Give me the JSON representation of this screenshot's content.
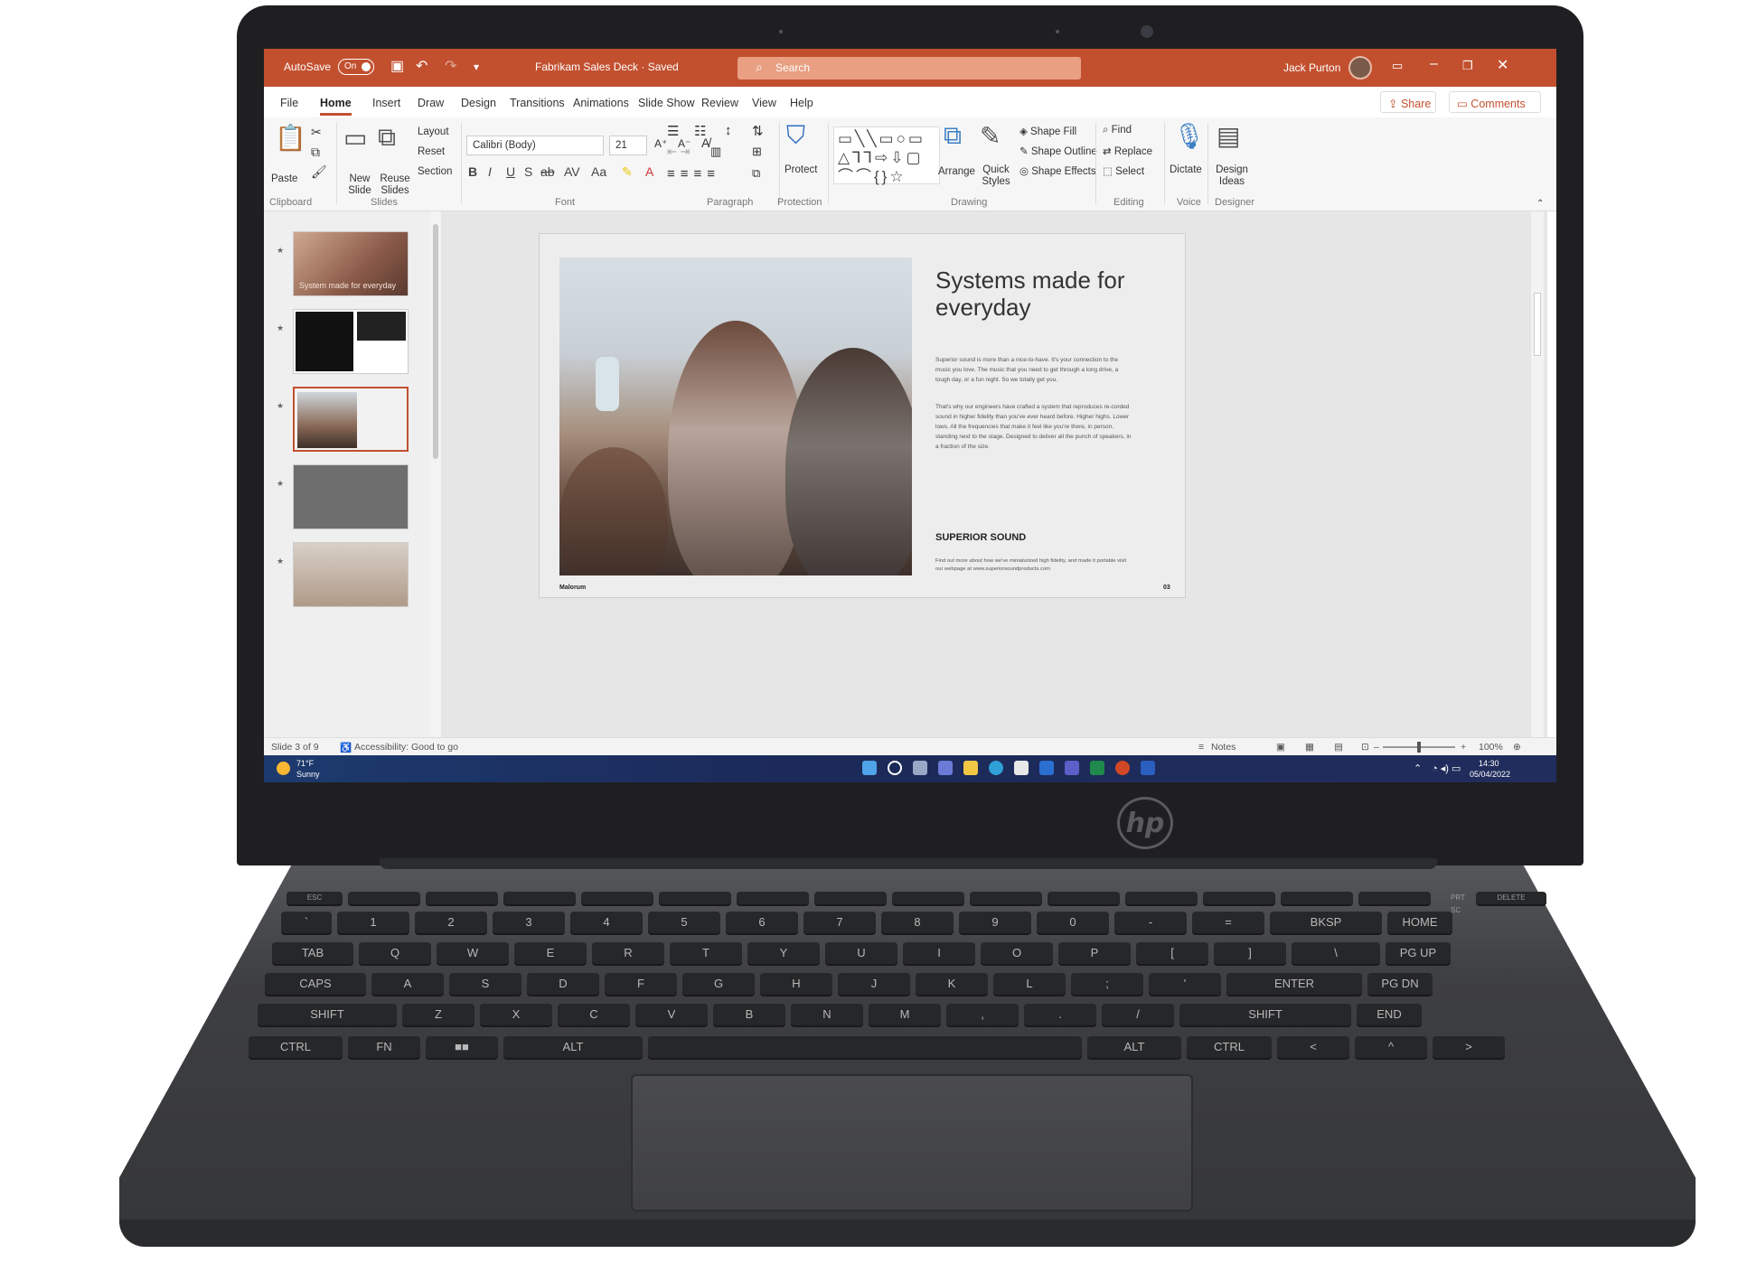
{
  "titlebar": {
    "autosave_label": "AutoSave",
    "autosave_state": "On",
    "document_name": "Fabrikam Sales Deck · Saved",
    "search_placeholder": "Search",
    "user_name": "Jack Purton"
  },
  "tabs": [
    "File",
    "Home",
    "Insert",
    "Draw",
    "Design",
    "Transitions",
    "Animations",
    "Slide Show",
    "Review",
    "View",
    "Help"
  ],
  "active_tab": "Home",
  "share_label": "Share",
  "comments_label": "Comments",
  "ribbon": {
    "paste": "Paste",
    "new_slide": "New Slide",
    "reuse_slides": "Reuse Slides",
    "layout": "Layout",
    "reset": "Reset",
    "section": "Section",
    "font_name": "Calibri (Body)",
    "font_size": "21",
    "protect": "Protect",
    "arrange": "Arrange",
    "quick_styles": "Quick Styles",
    "shape_fill": "Shape Fill",
    "shape_outline": "Shape Outline",
    "shape_effects": "Shape Effects",
    "find": "Find",
    "replace": "Replace",
    "select": "Select",
    "dictate": "Dictate",
    "design_ideas": "Design Ideas",
    "groups": {
      "clipboard": "Clipboard",
      "slides": "Slides",
      "font": "Font",
      "paragraph": "Paragraph",
      "protection": "Protection",
      "drawing": "Drawing",
      "editing": "Editing",
      "voice": "Voice",
      "designer": "Designer"
    }
  },
  "thumbnails": {
    "slide1_caption": "System made for everyday"
  },
  "slide": {
    "title": "Systems made for everyday",
    "body1": "Superior sound is more than a nice-to-have. It's your connection to the music you love. The music that you need to get through a long drive, a tough day, or a fun night. So we totally get you.",
    "body2": "That's why our engineers have crafted a system that reproduces re-corded sound in higher fidelity than you've ever heard before. Higher highs. Lower lows. All the frequencies that make it feel like you're there, in person, standing next to the stage. Designed to deliver all the punch of speakers, in a fraction of the size.",
    "heading": "SUPERIOR SOUND",
    "footer": "Find out more about how we've miniaturized high fidelity, and made it portable visit our webpage at www.superiorsoundproducts.com",
    "brand": "Malorum",
    "page_number": "03"
  },
  "status": {
    "slide_info": "Slide 3 of 9",
    "accessibility": "Accessibility: Good to go",
    "notes": "Notes",
    "zoom": "100%"
  },
  "taskbar": {
    "temperature": "71°F",
    "weather": "Sunny",
    "time": "14:30",
    "date": "05/04/2022"
  },
  "keyboard": {
    "row_num": [
      "`",
      "1",
      "2",
      "3",
      "4",
      "5",
      "6",
      "7",
      "8",
      "9",
      "0",
      "-",
      "=",
      "BKSP",
      "HOME"
    ],
    "row_q": [
      "TAB",
      "Q",
      "W",
      "E",
      "R",
      "T",
      "Y",
      "U",
      "I",
      "O",
      "P",
      "[",
      "]",
      "\\",
      "PG UP"
    ],
    "row_a": [
      "CAPS",
      "A",
      "S",
      "D",
      "F",
      "G",
      "H",
      "J",
      "K",
      "L",
      ";",
      "'",
      "ENTER",
      "PG DN"
    ],
    "row_z": [
      "SHIFT",
      "Z",
      "X",
      "C",
      "V",
      "B",
      "N",
      "M",
      ",",
      ".",
      "/",
      "SHIFT",
      "END"
    ],
    "row_bottom": [
      "CTRL",
      "FN",
      "■■",
      "ALT",
      "",
      "ALT",
      "CTRL",
      "<",
      "^",
      ">"
    ],
    "esc": "ESC",
    "delete": "DELETE",
    "prt_sc": "PRT SC"
  },
  "brand_logo": "hp"
}
